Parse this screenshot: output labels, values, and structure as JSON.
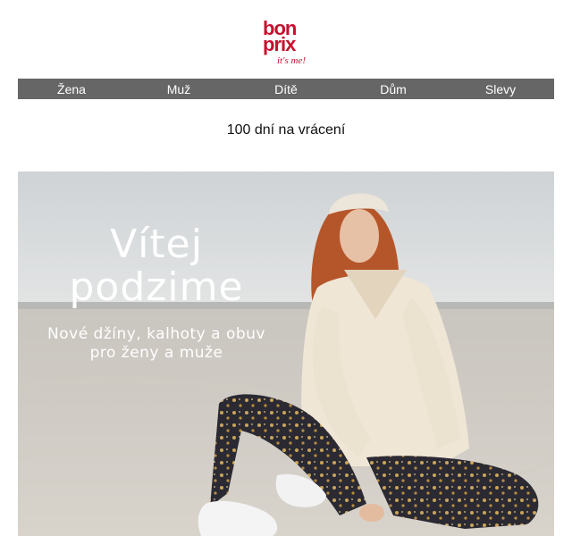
{
  "brand": {
    "logo_line1": "bon",
    "logo_line2": "prix",
    "tagline": "it's me!",
    "color": "#c8102e"
  },
  "nav": {
    "items": [
      {
        "label": "Žena"
      },
      {
        "label": "Muž"
      },
      {
        "label": "Dítě"
      },
      {
        "label": "Dům"
      },
      {
        "label": "Slevy"
      }
    ],
    "background": "#666666"
  },
  "returns": {
    "text": "100 dní na vrácení"
  },
  "hero": {
    "title_line1": "Vítej",
    "title_line2": "podzime",
    "subtitle_line1": "Nové džíny, kalhoty a obuv",
    "subtitle_line2": "pro ženy a muže"
  }
}
